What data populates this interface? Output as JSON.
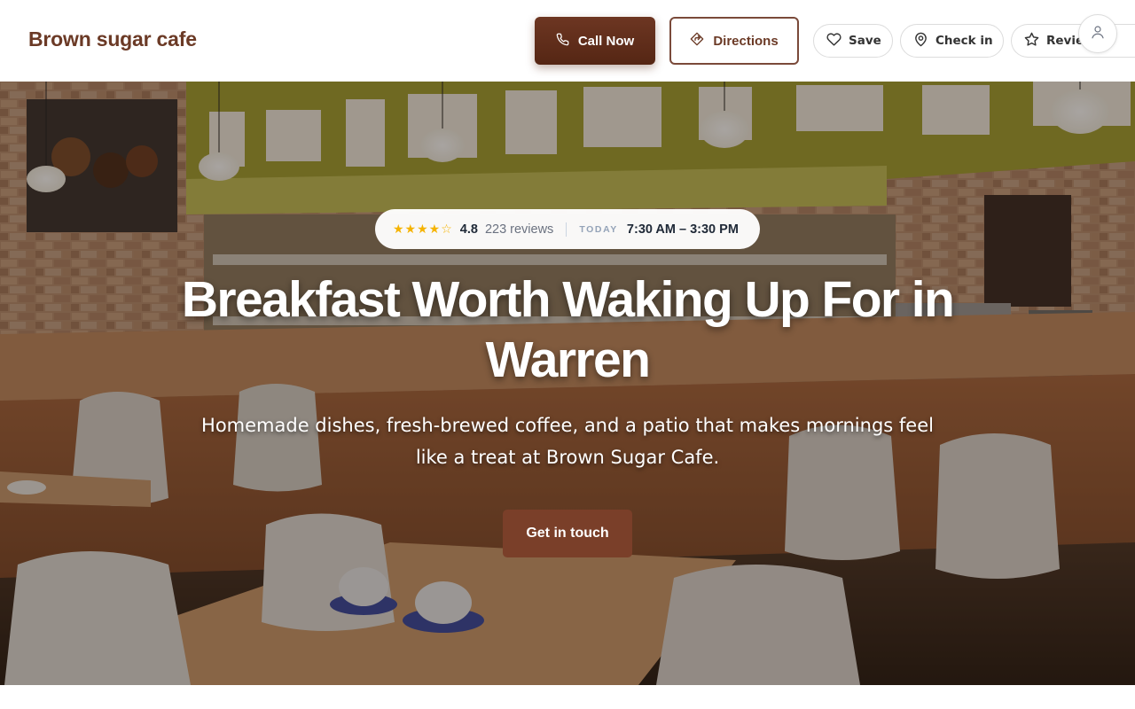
{
  "header": {
    "brand": "Brown sugar cafe",
    "call_label": "Call Now",
    "directions_label": "Directions",
    "save_label": "Save",
    "checkin_label": "Check in",
    "review_label": "Review"
  },
  "hero": {
    "stars": "★★★★☆",
    "rating": "4.8",
    "reviews": "223 reviews",
    "today_label": "TODAY",
    "hours": "7:30 AM – 3:30 PM",
    "headline": "Breakfast Worth Waking Up For in Warren",
    "subheadline": "Homemade dishes, fresh-brewed coffee, and a patio that makes mornings feel like a treat at Brown Sugar Cafe.",
    "cta_label": "Get in touch"
  },
  "colors": {
    "brand": "#6b3a26",
    "primary_button": "#6d3622",
    "cta": "#7a3f29",
    "star": "#f5b301"
  },
  "icons": [
    "phone-icon",
    "directions-icon",
    "heart-icon",
    "location-pin-icon",
    "star-icon",
    "user-icon"
  ]
}
